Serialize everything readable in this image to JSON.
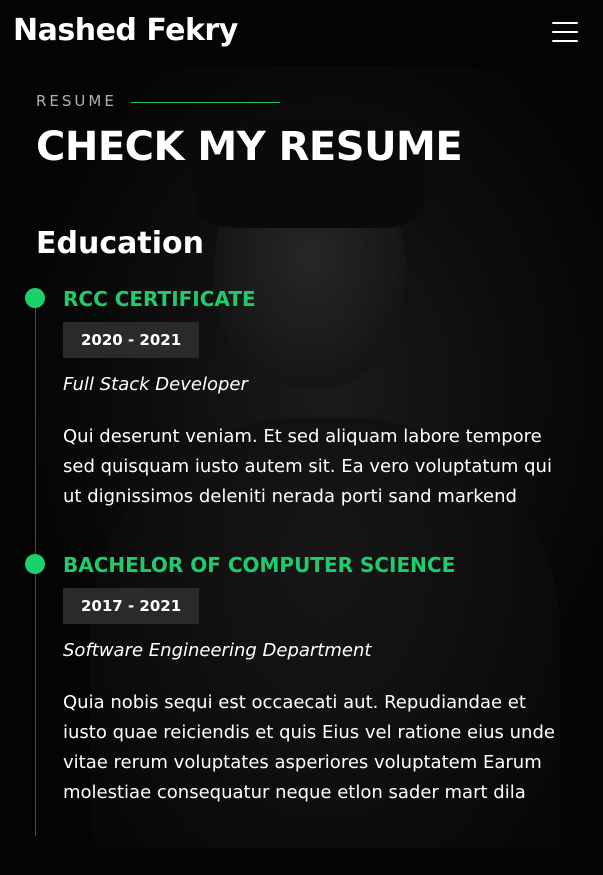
{
  "header": {
    "brand": "Nashed Fekry",
    "menu_icon": "hamburger-menu-icon"
  },
  "section": {
    "tag": "RESUME",
    "title": "CHECK MY RESUME",
    "accent_color": "#19c26a"
  },
  "education": {
    "heading": "Education",
    "items": [
      {
        "title": "RCC CERTIFICATE",
        "date": "2020 - 2021",
        "role": "Full Stack Developer",
        "description": "Qui deserunt veniam. Et sed aliquam labore tempore sed quisquam iusto autem sit. Ea vero voluptatum qui ut dignissimos deleniti nerada porti sand markend"
      },
      {
        "title": "BACHELOR OF COMPUTER SCIENCE",
        "date": "2017 - 2021",
        "role": "Software Engineering Department",
        "description": "Quia nobis sequi est occaecati aut. Repudiandae et iusto quae reiciendis et quis Eius vel ratione eius unde vitae rerum voluptates asperiores voluptatem Earum molestiae consequatur neque etlon sader mart dila"
      }
    ]
  }
}
